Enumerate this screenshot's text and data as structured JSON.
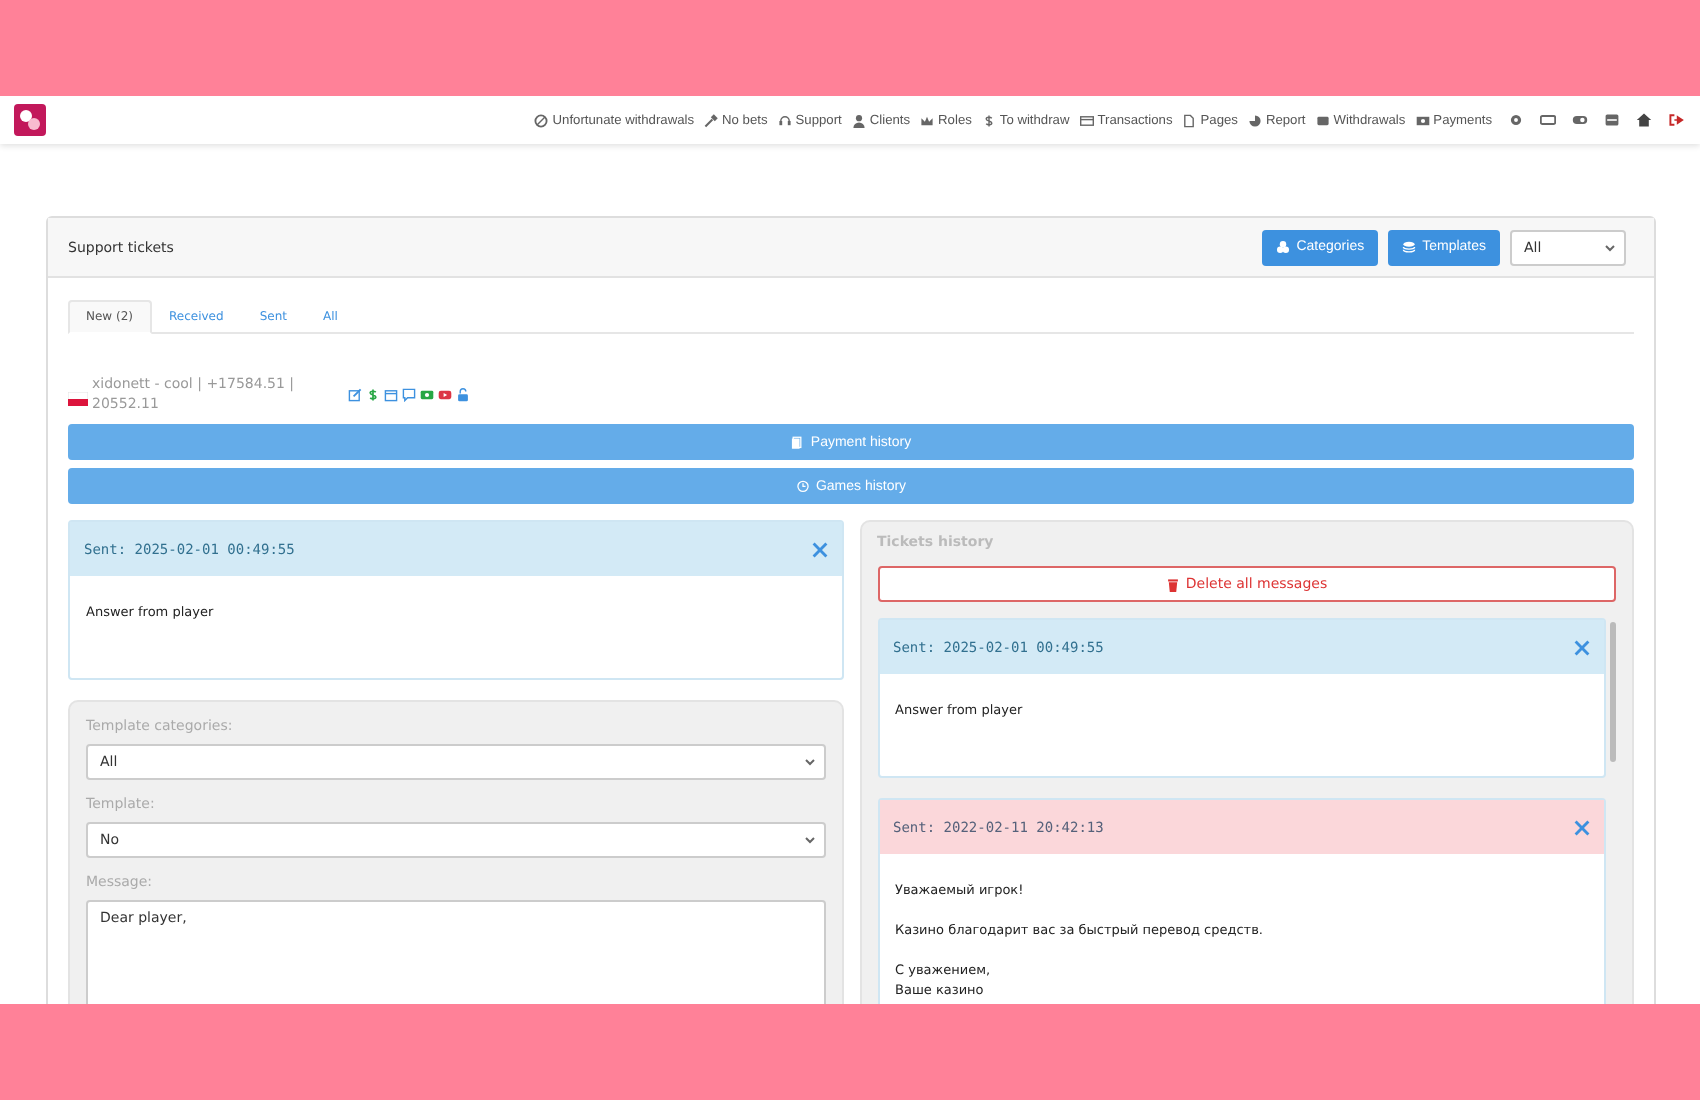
{
  "nav": {
    "items": [
      {
        "label": "Unfortunate withdrawals"
      },
      {
        "label": "No bets"
      },
      {
        "label": "Support"
      },
      {
        "label": "Clients"
      },
      {
        "label": "Roles"
      },
      {
        "label": "To withdraw"
      },
      {
        "label": "Transactions"
      },
      {
        "label": "Pages"
      },
      {
        "label": "Report"
      },
      {
        "label": "Withdrawals"
      },
      {
        "label": "Payments"
      }
    ]
  },
  "card": {
    "title": "Support tickets",
    "buttons": [
      "Categories",
      "Templates"
    ],
    "filter": {
      "value": "All"
    }
  },
  "tabs": [
    {
      "label": "New (2)",
      "selected": true
    },
    {
      "label": "Received",
      "selected": false
    },
    {
      "label": "Sent",
      "selected": false
    },
    {
      "label": "All",
      "selected": false
    }
  ],
  "player": {
    "info": "xidonett - cool | +17584.51 | 20552.11"
  },
  "history_buttons": [
    "Payment history",
    "Games history"
  ],
  "current_message": {
    "kind": "player",
    "sent": "Sent: 2025-02-01 00:49:55",
    "text": "Answer from player"
  },
  "form": {
    "category_label": "Template categories:",
    "category_value": "All",
    "template_label": "Template:",
    "template_value": "No",
    "message_label": "Message:",
    "message_value": "Dear player,"
  },
  "tickets_history": {
    "title": "Tickets history",
    "delete_button": "Delete all messages",
    "messages": [
      {
        "kind": "player",
        "sent": "Sent: 2025-02-01 00:49:55",
        "text": "Answer from player"
      },
      {
        "kind": "operator",
        "sent": "Sent: 2022-02-11 20:42:13",
        "text": "Уважаемый игрок!\n\nКазино благодарит вас за быстрый перевод средств.\n\nС уважением,\nВаше казино"
      }
    ]
  }
}
